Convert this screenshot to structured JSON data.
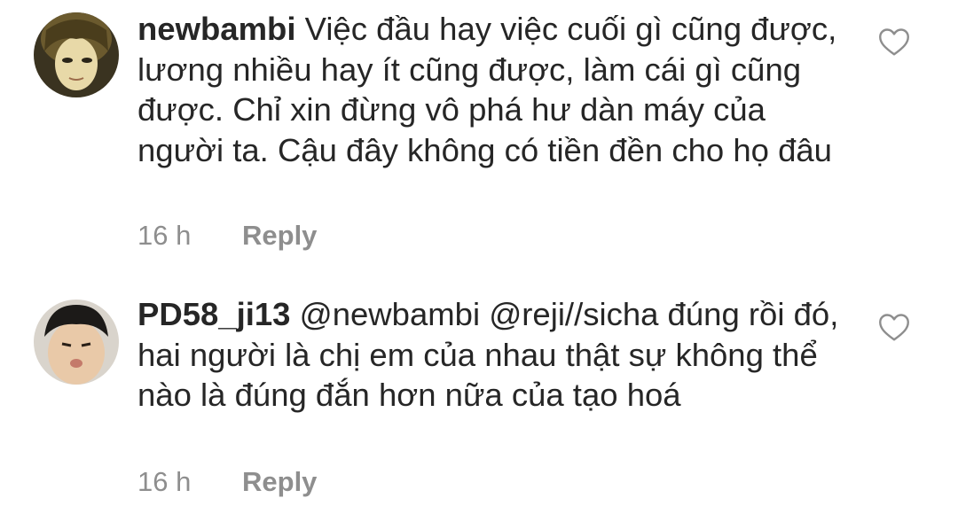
{
  "comments": [
    {
      "username": "newbambi",
      "text": "Việc đầu hay việc cuối gì cũng được, lương nhiều hay ít cũng được, làm cái gì cũng được. Chỉ xin đừng vô phá hư dàn máy của người ta. Cậu đây không có tiền đền cho họ đâu",
      "time": "16 h",
      "reply_label": "Reply",
      "avatar_icon": "avatar-icon",
      "like_icon": "heart-outline-icon"
    },
    {
      "username": "PD58_ji13",
      "text": "@newbambi @reji//sicha đúng rồi đó, hai người là chị em của nhau thật sự không thể nào là đúng đắn hơn nữa của tạo hoá",
      "time": "16 h",
      "reply_label": "Reply",
      "avatar_icon": "avatar-icon",
      "like_icon": "heart-outline-icon"
    }
  ],
  "colors": {
    "text": "#262626",
    "secondary": "#8e8e8e",
    "background": "#ffffff"
  }
}
